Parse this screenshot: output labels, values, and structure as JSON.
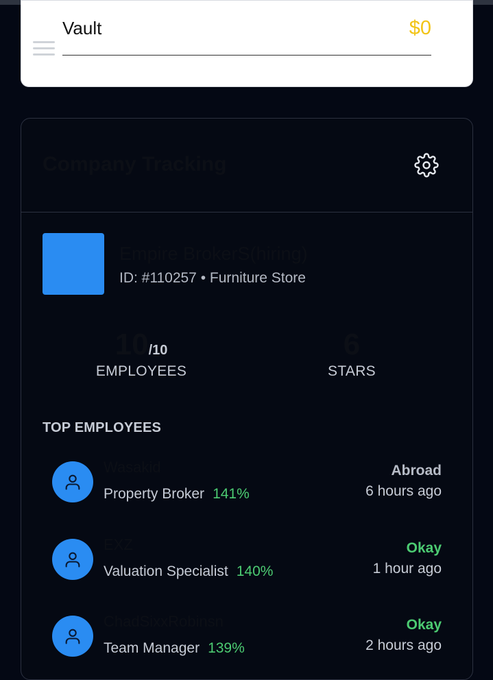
{
  "vault": {
    "label": "Vault",
    "amount": "$0"
  },
  "company": {
    "title": "Company Tracking",
    "name": "Empire BrokerS(hiring)",
    "meta": "ID: #110257 • Furniture Store",
    "logo_color": "#2a8cf2",
    "stats": {
      "employees": {
        "value": "10",
        "suffix": "/10",
        "label": "EMPLOYEES"
      },
      "stars": {
        "value": "6",
        "label": "STARS"
      }
    }
  },
  "top_employees": {
    "title": "TOP EMPLOYEES",
    "items": [
      {
        "name": "Wasakid",
        "role": "Property Broker",
        "percent": "141%",
        "status": "Abroad",
        "status_color": "#b7bcc7",
        "time": "6 hours ago"
      },
      {
        "name": "EXZ",
        "role": "Valuation Specialist",
        "percent": "140%",
        "status": "Okay",
        "status_color": "#4ccb72",
        "time": "1 hour ago"
      },
      {
        "name": "ChadSixxRobinsn",
        "role": "Team Manager",
        "percent": "139%",
        "status": "Okay",
        "status_color": "#4ccb72",
        "time": "2 hours ago"
      }
    ]
  },
  "colors": {
    "accent": "#2a8cf2",
    "success": "#4ccb72",
    "gold": "#f2c417",
    "background": "#040814"
  },
  "icons": {
    "settings": "gear-icon",
    "avatar": "user-icon",
    "handle": "menu-icon"
  }
}
